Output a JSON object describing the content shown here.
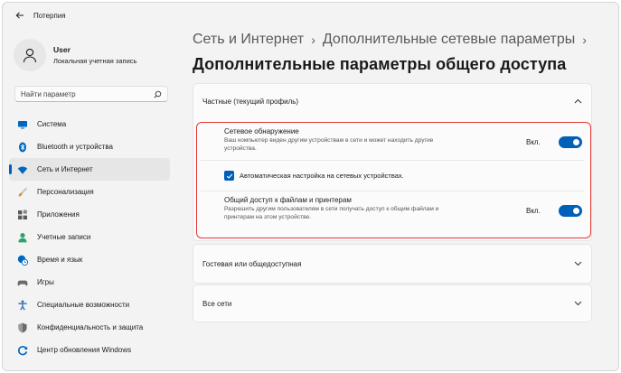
{
  "window": {
    "title": "Потерпия"
  },
  "profile": {
    "name": "User",
    "subtitle": "Локальная учетная запись"
  },
  "search": {
    "placeholder": "Найти параметр"
  },
  "nav": {
    "items": [
      {
        "label": "Система",
        "icon": "monitor-icon",
        "color": "#0067c0"
      },
      {
        "label": "Bluetooth и устройства",
        "icon": "bluetooth-icon",
        "color": "#0067c0"
      },
      {
        "label": "Сеть и Интернет",
        "icon": "wifi-icon",
        "color": "#0067c0",
        "active": true
      },
      {
        "label": "Персонализация",
        "icon": "paintbrush-icon",
        "color": "#d47a1f"
      },
      {
        "label": "Приложения",
        "icon": "apps-icon",
        "color": "#5b5b5b"
      },
      {
        "label": "Учетные записи",
        "icon": "person-icon",
        "color": "#2ba36c"
      },
      {
        "label": "Время и язык",
        "icon": "globe-clock-icon",
        "color": "#0067c0"
      },
      {
        "label": "Игры",
        "icon": "gamepad-icon",
        "color": "#6b6b6b"
      },
      {
        "label": "Специальные возможности",
        "icon": "accessibility-icon",
        "color": "#2b6fb6"
      },
      {
        "label": "Конфиденциальность и защита",
        "icon": "shield-icon",
        "color": "#6b6b6b"
      },
      {
        "label": "Центр обновления Windows",
        "icon": "update-icon",
        "color": "#0067c0"
      }
    ]
  },
  "breadcrumb": {
    "parent": "Сеть и Интернет",
    "separator": "›",
    "current": "Дополнительные сетевые параметры",
    "trailing": "›"
  },
  "page_title": "Дополнительные параметры общего доступа",
  "sections": {
    "private": {
      "title": "Частные (текущий профиль)",
      "network_discovery": {
        "title": "Сетевое обнаружение",
        "description": "Ваш компьютер виден другим устройствам в сети и может находить другие устройства.",
        "state": "Вкл."
      },
      "auto_setup": {
        "label": "Автоматическая настройка на сетевых устройствах."
      },
      "file_sharing": {
        "title": "Общий доступ к файлам и принтерам",
        "description": "Разрешить другим пользователям в сети получать доступ к общим файлам и принтерам на этом устройстве.",
        "state": "Вкл."
      }
    },
    "guest": {
      "title": "Гостевая или общедоступная"
    },
    "all": {
      "title": "Все сети"
    }
  },
  "colors": {
    "accent": "#005fb8",
    "highlight": "#e53935"
  }
}
